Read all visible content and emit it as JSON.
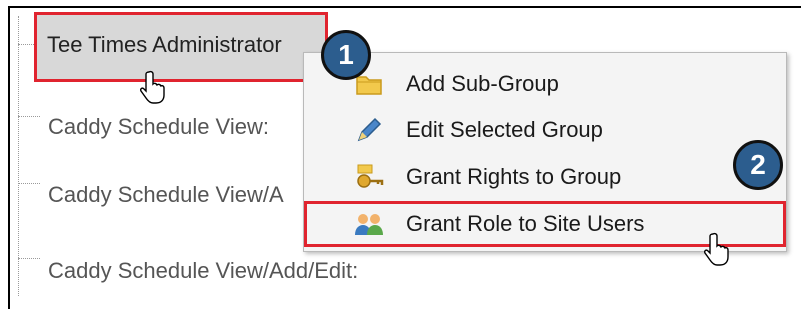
{
  "tree": {
    "items": [
      {
        "label": "Tee Times Administrator"
      },
      {
        "label": "Caddy Schedule View:"
      },
      {
        "label": "Caddy Schedule View/A"
      },
      {
        "label": "Caddy Schedule View/Add/Edit:"
      }
    ]
  },
  "context_menu": {
    "items": [
      {
        "label": "Add Sub-Group",
        "icon": "folder-icon"
      },
      {
        "label": "Edit Selected Group",
        "icon": "pencil-icon"
      },
      {
        "label": "Grant Rights to Group",
        "icon": "key-icon"
      },
      {
        "label": "Grant Role to Site Users",
        "icon": "users-icon"
      }
    ]
  },
  "callouts": [
    {
      "number": "1"
    },
    {
      "number": "2"
    }
  ],
  "colors": {
    "highlight_border": "#e0242f",
    "badge_fill": "#2c5d8e"
  }
}
